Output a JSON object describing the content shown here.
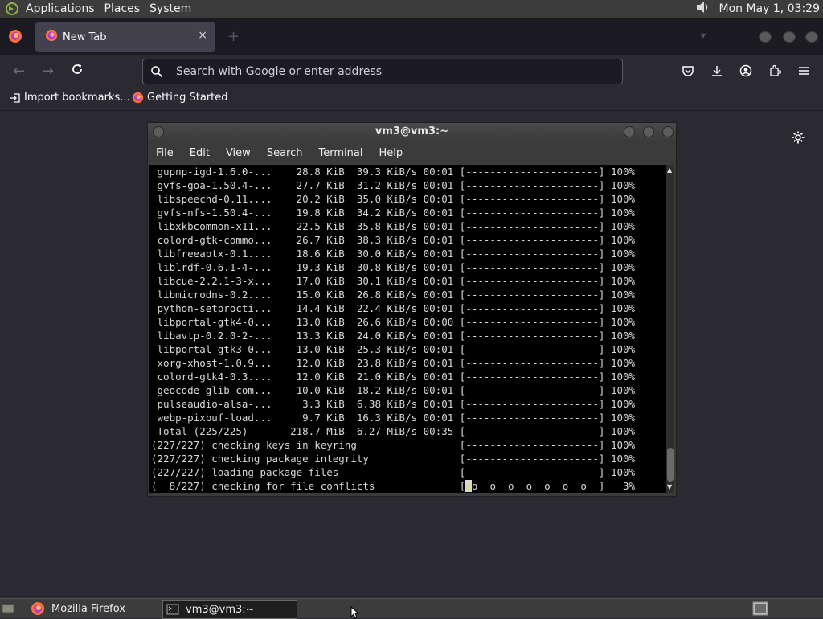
{
  "top_panel": {
    "menus": [
      "Applications",
      "Places",
      "System"
    ],
    "clock": "Mon May  1, 03:29"
  },
  "browser": {
    "tab": {
      "title": "New Tab",
      "close": "×"
    },
    "new_tab": "+",
    "url_placeholder": "Search with Google or enter address",
    "bookmarks": [
      "Import bookmarks...",
      "Getting Started"
    ]
  },
  "terminal": {
    "title": "vm3@vm3:~",
    "menu": [
      "File",
      "Edit",
      "View",
      "Search",
      "Terminal",
      "Help"
    ],
    "lines": [
      " gupnp-igd-1.6.0-...    28.8 KiB  39.3 KiB/s 00:01 [----------------------] 100%",
      " gvfs-goa-1.50.4-...    27.7 KiB  31.2 KiB/s 00:01 [----------------------] 100%",
      " libspeechd-0.11....    20.2 KiB  35.0 KiB/s 00:01 [----------------------] 100%",
      " gvfs-nfs-1.50.4-...    19.8 KiB  34.2 KiB/s 00:01 [----------------------] 100%",
      " libxkbcommon-x11...    22.5 KiB  35.8 KiB/s 00:01 [----------------------] 100%",
      " colord-gtk-commo...    26.7 KiB  38.3 KiB/s 00:01 [----------------------] 100%",
      " libfreeaptx-0.1....    18.6 KiB  30.0 KiB/s 00:01 [----------------------] 100%",
      " liblrdf-0.6.1-4-...    19.3 KiB  30.8 KiB/s 00:01 [----------------------] 100%",
      " libcue-2.2.1-3-x...    17.0 KiB  30.1 KiB/s 00:01 [----------------------] 100%",
      " libmicrodns-0.2....    15.0 KiB  26.8 KiB/s 00:01 [----------------------] 100%",
      " python-setprocti...    14.4 KiB  22.4 KiB/s 00:01 [----------------------] 100%",
      " libportal-gtk4-0...    13.0 KiB  26.6 KiB/s 00:00 [----------------------] 100%",
      " libavtp-0.2.0-2-...    13.3 KiB  24.0 KiB/s 00:01 [----------------------] 100%",
      " libportal-gtk3-0...    13.0 KiB  25.3 KiB/s 00:01 [----------------------] 100%",
      " xorg-xhost-1.0.9...    12.0 KiB  23.8 KiB/s 00:01 [----------------------] 100%",
      " colord-gtk4-0.3....    12.0 KiB  21.0 KiB/s 00:01 [----------------------] 100%",
      " geocode-glib-com...    10.0 KiB  18.2 KiB/s 00:01 [----------------------] 100%",
      " pulseaudio-alsa-...     3.3 KiB  6.38 KiB/s 00:01 [----------------------] 100%",
      " webp-pixbuf-load...     9.7 KiB  16.3 KiB/s 00:01 [----------------------] 100%",
      " Total (225/225)       218.7 MiB  6.27 MiB/s 00:35 [----------------------] 100%",
      "(227/227) checking keys in keyring                 [----------------------] 100%",
      "(227/227) checking package integrity               [----------------------] 100%",
      "(227/227) loading package files                    [----------------------] 100%"
    ],
    "last_line_prefix": "(  8/227) checking for file conflicts              [",
    "last_line_cursor": "c",
    "last_line_progress": "o  o  o  o  o  o  o  ]",
    "last_line_pct": "   3%"
  },
  "taskbar": {
    "items": [
      "Mozilla Firefox",
      "vm3@vm3:~"
    ]
  },
  "colors": {
    "browser_bg": "#2b2a33",
    "tabbar_bg": "#1c1b22",
    "terminal_bg": "#000000",
    "panel_bg": "#3c3c3c",
    "pacman_yellow": "#e8d44d"
  }
}
